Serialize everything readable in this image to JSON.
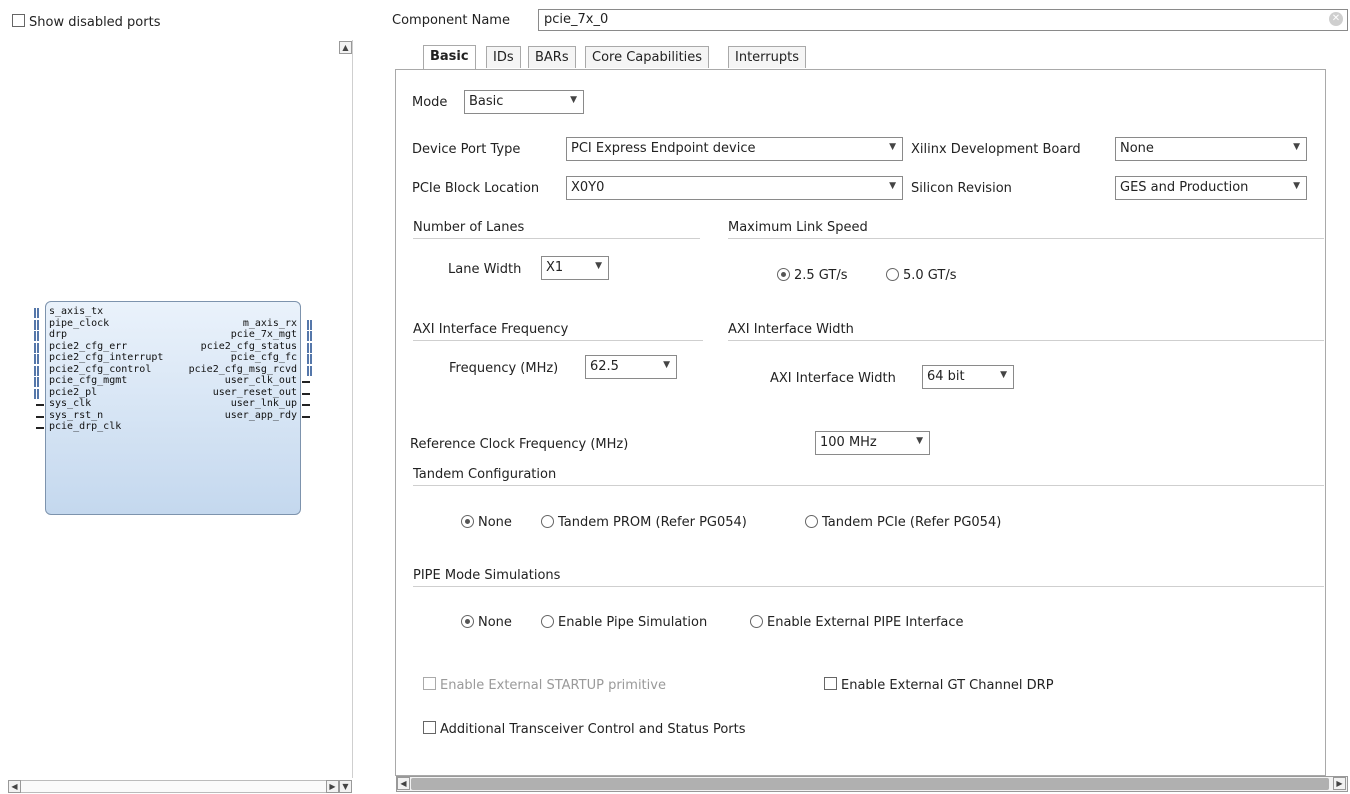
{
  "left_panel": {
    "show_disabled_ports_label": "Show disabled ports",
    "block": {
      "left_ports": [
        "s_axis_tx",
        "pipe_clock",
        "drp",
        "pcie2_cfg_err",
        "pcie2_cfg_interrupt",
        "pcie2_cfg_control",
        "pcie_cfg_mgmt",
        "pcie2_pl",
        "sys_clk",
        "sys_rst_n",
        "pcie_drp_clk"
      ],
      "right_ports": [
        "m_axis_rx",
        "pcie_7x_mgt",
        "pcie2_cfg_status",
        "pcie_cfg_fc",
        "pcie2_cfg_msg_rcvd",
        "user_clk_out",
        "user_reset_out",
        "user_lnk_up",
        "user_app_rdy"
      ]
    }
  },
  "component": {
    "name_label": "Component Name",
    "name_value": "pcie_7x_0"
  },
  "tabs": [
    "Basic",
    "IDs",
    "BARs",
    "Core Capabilities",
    "Interrupts"
  ],
  "basic": {
    "mode_label": "Mode",
    "mode_value": "Basic",
    "device_port_type_label": "Device Port Type",
    "device_port_type_value": "PCI Express Endpoint device",
    "dev_board_label": "Xilinx Development Board",
    "dev_board_value": "None",
    "block_location_label": "PCIe Block Location",
    "block_location_value": "X0Y0",
    "silicon_revision_label": "Silicon Revision",
    "silicon_revision_value": "GES and Production",
    "lanes_section": "Number of Lanes",
    "lane_width_label": "Lane Width",
    "lane_width_value": "X1",
    "link_speed_section": "Maximum Link Speed",
    "speed_opt1": "2.5 GT/s",
    "speed_opt2": "5.0 GT/s",
    "axi_freq_section": "AXI Interface Frequency",
    "freq_label": "Frequency (MHz)",
    "freq_value": "62.5",
    "axi_width_section": "AXI Interface Width",
    "axi_width_label": "AXI Interface Width",
    "axi_width_value": "64 bit",
    "ref_clk_label": "Reference Clock Frequency (MHz)",
    "ref_clk_value": "100 MHz",
    "tandem_section": "Tandem Configuration",
    "tandem_opt1": "None",
    "tandem_opt2": "Tandem PROM (Refer PG054)",
    "tandem_opt3": "Tandem PCIe (Refer PG054)",
    "pipe_section": "PIPE Mode Simulations",
    "pipe_opt1": "None",
    "pipe_opt2": "Enable Pipe Simulation",
    "pipe_opt3": "Enable External PIPE Interface",
    "startup_label": "Enable External STARTUP primitive",
    "gt_drp_label": "Enable External GT Channel DRP",
    "transceiver_label": "Additional Transceiver Control and Status Ports"
  },
  "colors": {
    "block_fill": "#c4d8ee",
    "block_border": "#7d93ad",
    "scrollbar": "#b0b0b0"
  }
}
